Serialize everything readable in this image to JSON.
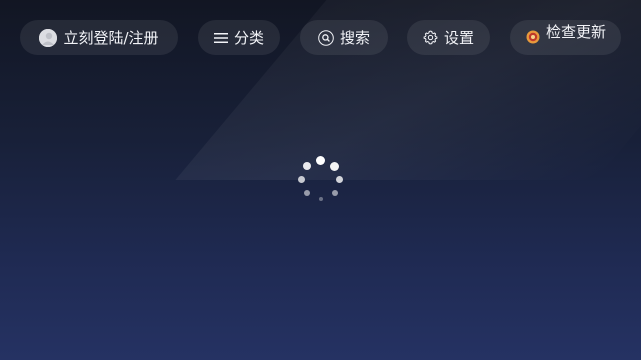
{
  "topbar": {
    "login_label": "立刻登陆/注册",
    "category_label": "分类",
    "search_label": "搜索",
    "settings_label": "设置",
    "update_label": "检查更新"
  },
  "icons": {
    "login": "user-avatar-icon",
    "category": "hamburger-menu-icon",
    "search": "magnifier-icon",
    "settings": "gear-icon",
    "update": "update-badge-icon"
  },
  "main": {
    "status": "loading"
  },
  "colors": {
    "background_top": "#121623",
    "background_bottom": "#253263",
    "pill_background": "rgba(255,255,255,0.08)",
    "text": "#f2f3f7",
    "update_badge": "#e89a3c"
  }
}
